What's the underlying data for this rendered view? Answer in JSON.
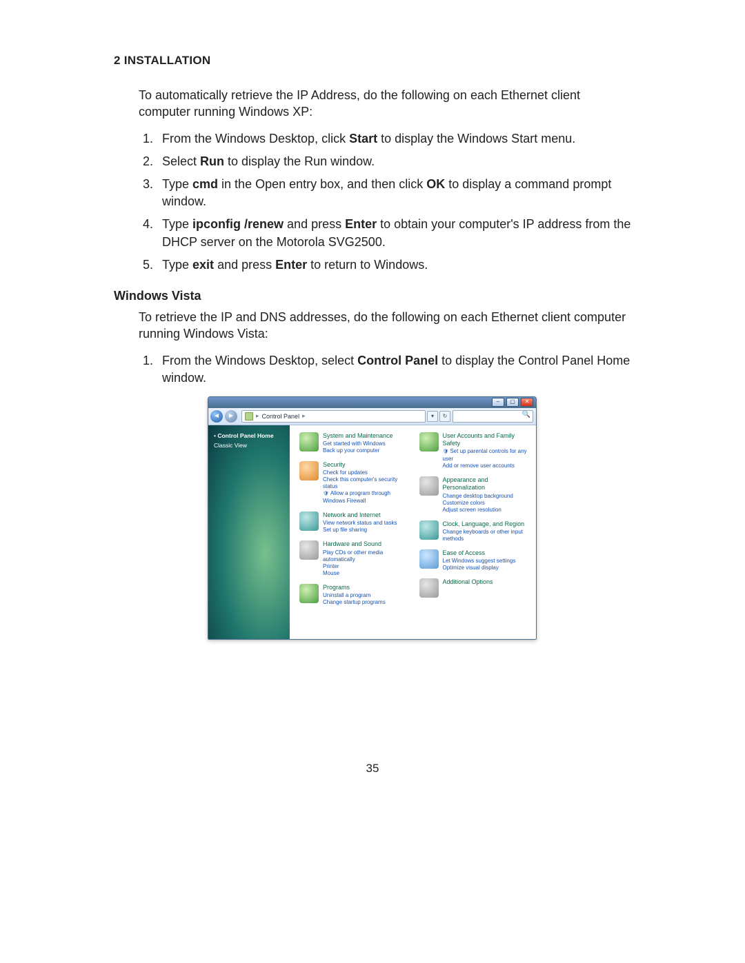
{
  "page_number": "35",
  "header": "2 INSTALLATION",
  "xp": {
    "intro": "To automatically retrieve the IP Address, do the following on each Ethernet client computer running Windows XP:",
    "steps": [
      {
        "pre": "From the Windows Desktop, click ",
        "bold1": "Start",
        "post": " to display the Windows Start menu."
      },
      {
        "pre": "Select ",
        "bold1": "Run",
        "post": " to display the Run window."
      },
      {
        "pre": "Type ",
        "bold1": "cmd",
        "mid": " in the Open entry box, and then click ",
        "bold2": "OK",
        "post": " to display a command prompt window."
      },
      {
        "pre": "Type ",
        "bold1": "ipconfig /renew",
        "mid": " and press ",
        "bold2": "Enter",
        "post": " to obtain your computer's IP address from the DHCP server on the Motorola SVG2500."
      },
      {
        "pre": "Type ",
        "bold1": "exit",
        "mid": " and press ",
        "bold2": "Enter",
        "post": " to return to Windows."
      }
    ]
  },
  "vista": {
    "heading": "Windows Vista",
    "intro": "To retrieve the IP and DNS addresses, do the following on each Ethernet client computer running Windows Vista:",
    "step1": {
      "pre": "From the Windows Desktop, select ",
      "bold1": "Control Panel",
      "post": " to display the Control Panel Home window."
    }
  },
  "cp": {
    "breadcrumb": "Control Panel",
    "sidebar": {
      "home": "Control Panel Home",
      "classic": "Classic View"
    },
    "left_col": [
      {
        "title": "System and Maintenance",
        "links": [
          "Get started with Windows",
          "Back up your computer"
        ],
        "icon": "green"
      },
      {
        "title": "Security",
        "links": [
          "Check for updates",
          "Check this computer's security status",
          "Allow a program through Windows Firewall"
        ],
        "icon": "orange",
        "shield_on": 2
      },
      {
        "title": "Network and Internet",
        "links": [
          "View network status and tasks",
          "Set up file sharing"
        ],
        "icon": "teal"
      },
      {
        "title": "Hardware and Sound",
        "links": [
          "Play CDs or other media automatically",
          "Printer",
          "Mouse"
        ],
        "icon": "gray"
      },
      {
        "title": "Programs",
        "links": [
          "Uninstall a program",
          "Change startup programs"
        ],
        "icon": "green"
      }
    ],
    "right_col": [
      {
        "title": "User Accounts and Family Safety",
        "links": [
          "Set up parental controls for any user",
          "Add or remove user accounts"
        ],
        "icon": "green",
        "shield_on": 0
      },
      {
        "title": "Appearance and Personalization",
        "links": [
          "Change desktop background",
          "Customize colors",
          "Adjust screen resolution"
        ],
        "icon": "gray"
      },
      {
        "title": "Clock, Language, and Region",
        "links": [
          "Change keyboards or other input methods"
        ],
        "icon": "teal"
      },
      {
        "title": "Ease of Access",
        "links": [
          "Let Windows suggest settings",
          "Optimize visual display"
        ],
        "icon": "blue"
      },
      {
        "title": "Additional Options",
        "links": [],
        "icon": "gray"
      }
    ]
  }
}
